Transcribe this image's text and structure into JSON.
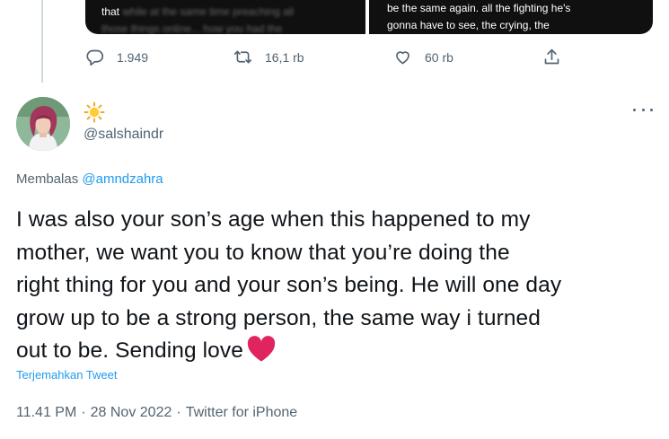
{
  "quoted_media": {
    "left_visible_text": "that",
    "left_blurred_text_1": "while at the same time preaching all",
    "left_blurred_text_2": "those things online... how you had the",
    "right_line_1": "be the same again. all the fighting he's",
    "right_line_2": "gonna have to see, the crying, the"
  },
  "actions": {
    "reply_count": "1.949",
    "retweet_count": "16,1 rb",
    "like_count": "60 rb"
  },
  "tweet": {
    "display_name_emoji": "☀️",
    "handle": "@salshaindr",
    "reply_prefix": "Membalas",
    "reply_to_handle": "@amndzahra",
    "text_line_1": "I was also your son’s age when this happened to my",
    "text_line_2": "mother, we want you to know that you’re doing the",
    "text_line_3": "right thing for you and your son’s being. He will one day",
    "text_line_4": "grow up to be a strong person, the same way i turned",
    "text_line_5": "out to be. Sending love",
    "translate_label": "Terjemahkan Tweet",
    "time": "11.41 PM",
    "date": "28 Nov 2022",
    "source": "Twitter for iPhone",
    "separator": "·"
  },
  "colors": {
    "link": "#1d9bf0",
    "muted": "#536471",
    "heart": "#e0245e"
  }
}
